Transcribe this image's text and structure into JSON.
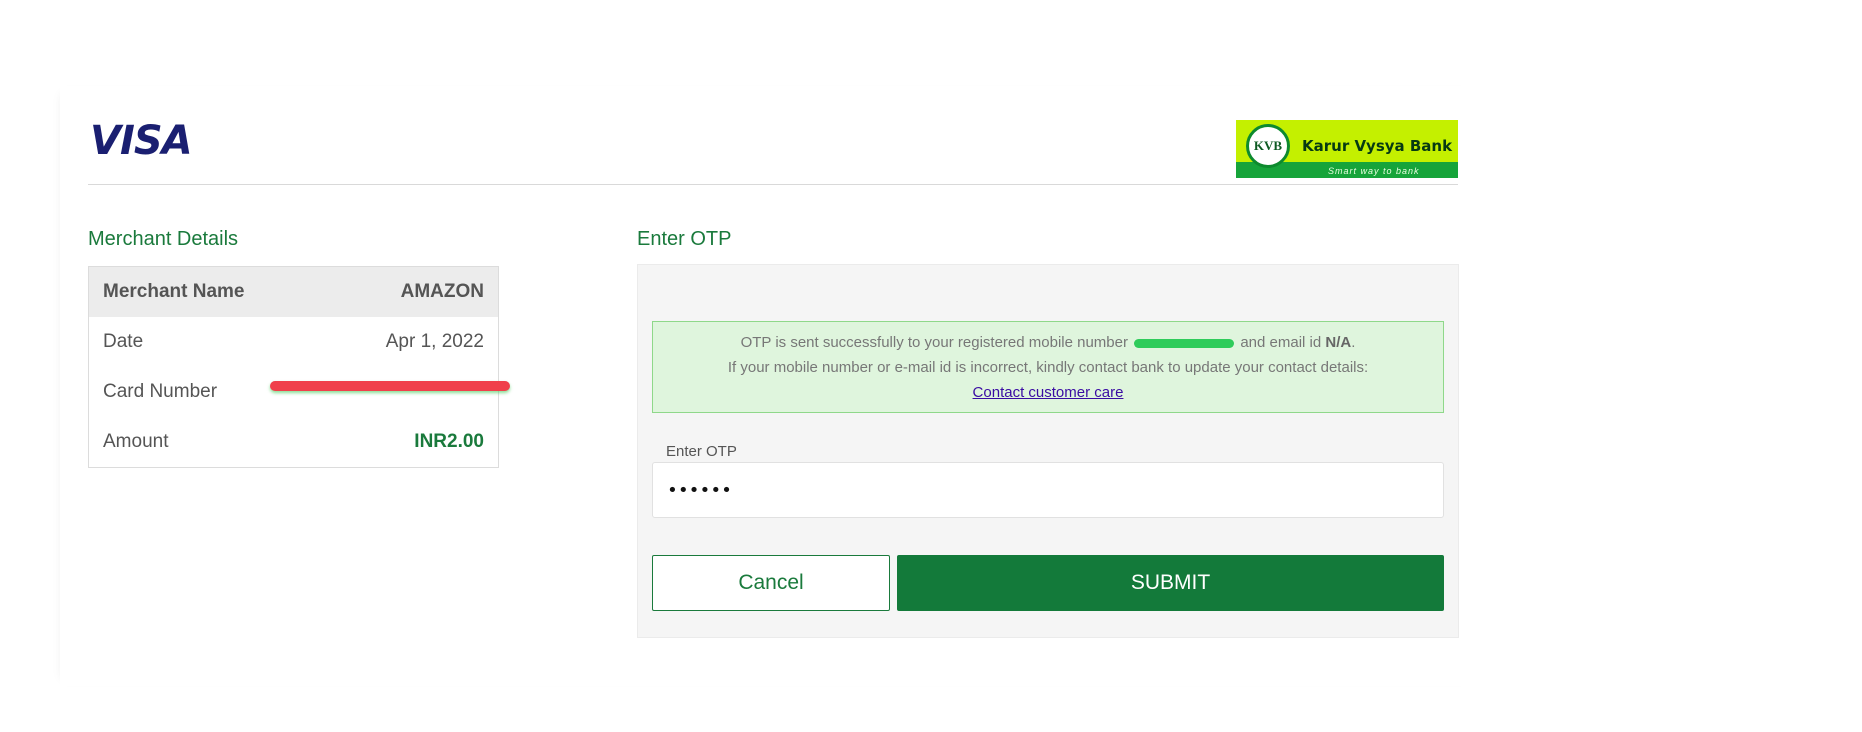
{
  "header": {
    "visa_logo": "VISA",
    "bank_logo": {
      "seal": "KVB",
      "name": "Karur Vysya Bank",
      "tagline": "Smart way to bank"
    }
  },
  "merchant": {
    "title": "Merchant Details",
    "rows": [
      {
        "label": "Merchant Name",
        "value": "AMAZON"
      },
      {
        "label": "Date",
        "value": "Apr 1, 2022"
      },
      {
        "label": "Card Number",
        "value": ""
      },
      {
        "label": "Amount",
        "value": "INR2.00"
      }
    ]
  },
  "otp": {
    "title": "Enter OTP",
    "message_part1": "OTP is sent successfully to your registered mobile number",
    "message_part2": "and email id",
    "email_value": "N/A",
    "message_line2": "If your mobile number or e-mail id is incorrect, kindly contact bank to update your contact details:",
    "contact_link": "Contact customer care",
    "input_label": "Enter OTP",
    "input_value": "••••••",
    "cancel_label": "Cancel",
    "submit_label": "SUBMIT"
  },
  "colors": {
    "brand_green": "#137a3a",
    "title_green": "#1a7a3c",
    "visa_blue": "#1a1f71",
    "kvb_lime": "#c4f000",
    "redaction_red": "#f0404a"
  }
}
